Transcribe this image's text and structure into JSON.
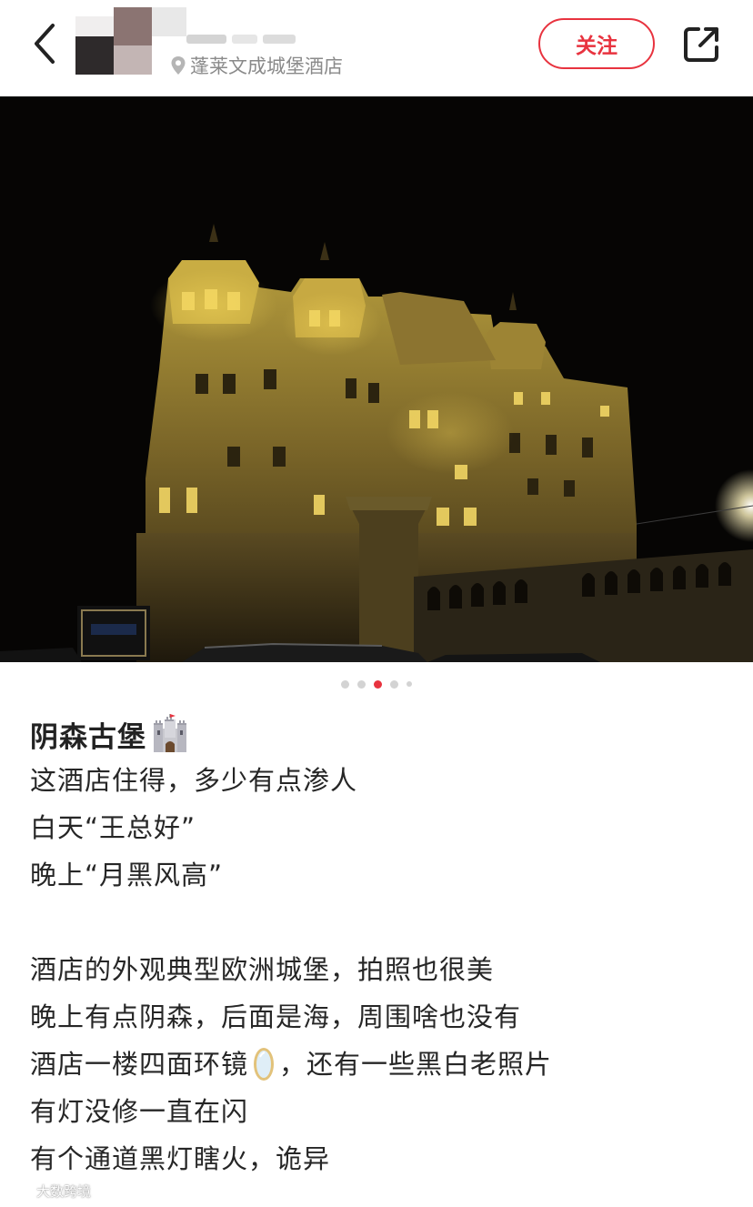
{
  "header": {
    "location": "蓬莱文成城堡酒店",
    "follow_label": "关注"
  },
  "icons": {
    "back": "chevron-left-icon",
    "location": "map-pin-icon",
    "share": "share-icon"
  },
  "carousel": {
    "total": 5,
    "active_index": 2
  },
  "post": {
    "title": "阴森古堡",
    "lines": [
      "这酒店住得，多少有点渗人",
      "白天“王总好”",
      "晚上“月黑风高”",
      "",
      "酒店的外观典型欧洲城堡，拍照也很美",
      "晚上有点阴森，后面是海，周围啥也没有",
      "酒店一楼四面环镜",
      "，还有一些黑白老照片",
      "有灯没修一直在闪",
      "有个通道黑灯瞎火，诡异"
    ]
  },
  "watermark": "大数跨境",
  "colors": {
    "accent": "#e8333f",
    "muted": "#8a8a8a"
  }
}
